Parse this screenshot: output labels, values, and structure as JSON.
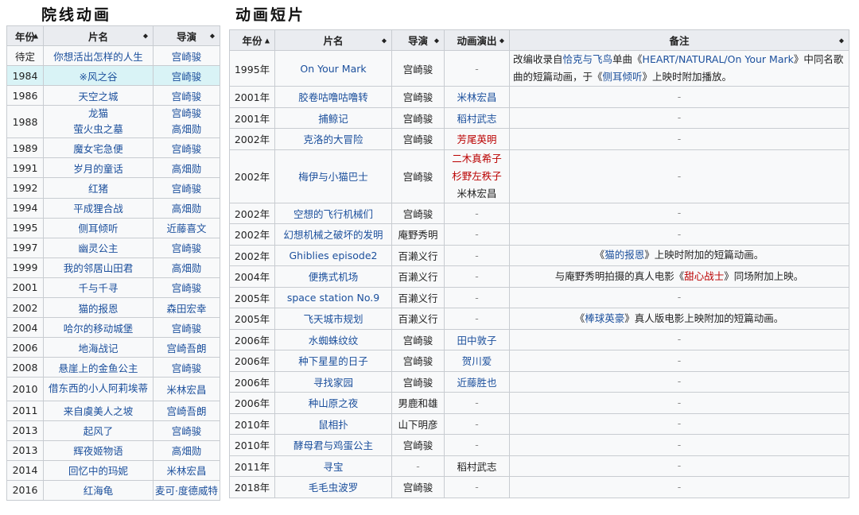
{
  "left": {
    "heading": "院线动画",
    "headers": [
      "年份",
      "片名",
      "导演"
    ],
    "rows": [
      {
        "year": "待定",
        "title": "你想活出怎样的人生",
        "director": [
          "宫崎骏"
        ]
      },
      {
        "year": "1984",
        "title": "※风之谷",
        "director": [
          "宫崎骏"
        ],
        "highlight": true
      },
      {
        "year": "1986",
        "title": "天空之城",
        "director": [
          "宫崎骏"
        ]
      },
      {
        "year": "1988",
        "title": "龙猫\n萤火虫之墓",
        "director": [
          "宫崎骏",
          "高畑勋"
        ]
      },
      {
        "year": "1989",
        "title": "魔女宅急便",
        "director": [
          "宫崎骏"
        ]
      },
      {
        "year": "1991",
        "title": "岁月的童话",
        "director": [
          "高畑勋"
        ]
      },
      {
        "year": "1992",
        "title": "红猪",
        "director": [
          "宫崎骏"
        ]
      },
      {
        "year": "1994",
        "title": "平成狸合战",
        "director": [
          "高畑勋"
        ]
      },
      {
        "year": "1995",
        "title": "侧耳倾听",
        "director": [
          "近藤喜文"
        ]
      },
      {
        "year": "1997",
        "title": "幽灵公主",
        "director": [
          "宫崎骏"
        ]
      },
      {
        "year": "1999",
        "title": "我的邻居山田君",
        "director": [
          "高畑勋"
        ]
      },
      {
        "year": "2001",
        "title": "千与千寻",
        "director": [
          "宫崎骏"
        ]
      },
      {
        "year": "2002",
        "title": "猫的报恩",
        "director": [
          "森田宏幸"
        ]
      },
      {
        "year": "2004",
        "title": "哈尔的移动城堡",
        "director": [
          "宫崎骏"
        ]
      },
      {
        "year": "2006",
        "title": "地海战记",
        "director": [
          "宫崎吾朗"
        ]
      },
      {
        "year": "2008",
        "title": "悬崖上的金鱼公主",
        "director": [
          "宫崎骏"
        ]
      },
      {
        "year": "2010",
        "title": "借东西的小人阿莉埃蒂",
        "director": [
          "米林宏昌"
        ]
      },
      {
        "year": "2011",
        "title": "来自虞美人之坡",
        "director": [
          "宫崎吾朗"
        ]
      },
      {
        "year": "2013",
        "title": "起风了",
        "director": [
          "宫崎骏"
        ]
      },
      {
        "year": "2013",
        "title": "辉夜姬物语",
        "director": [
          "高畑勋"
        ]
      },
      {
        "year": "2014",
        "title": "回忆中的玛妮",
        "director": [
          "米林宏昌"
        ]
      },
      {
        "year": "2016",
        "title": "红海龟",
        "director": [
          "麦可·度德威特"
        ]
      }
    ]
  },
  "right": {
    "heading": "动画短片",
    "headers": [
      "年份",
      "片名",
      "导演",
      "动画演出",
      "备注"
    ],
    "rows": [
      {
        "year": "1995年",
        "title": "On Your Mark",
        "director": "宫崎骏",
        "anim": [
          {
            "t": "-",
            "c": "dash"
          }
        ],
        "note": [
          {
            "t": "改编收录自",
            "c": "plain"
          },
          {
            "t": "恰克与飞鸟",
            "c": "link"
          },
          {
            "t": "单曲《",
            "c": "plain"
          },
          {
            "t": "HEART/NATURAL/On Your Mark",
            "c": "link"
          },
          {
            "t": "》中同名歌曲的短篇动画，于《",
            "c": "plain"
          },
          {
            "t": "侧耳倾听",
            "c": "link"
          },
          {
            "t": "》上映时附加播放。",
            "c": "plain"
          }
        ]
      },
      {
        "year": "2001年",
        "title": "胶卷咕噜咕噜转",
        "director": "宫崎骏",
        "anim": [
          {
            "t": "米林宏昌",
            "c": "link"
          }
        ],
        "note": [
          {
            "t": "-",
            "c": "dash"
          }
        ]
      },
      {
        "year": "2001年",
        "title": "捕鲸记",
        "director": "宫崎骏",
        "anim": [
          {
            "t": "稻村武志",
            "c": "link"
          }
        ],
        "note": [
          {
            "t": "-",
            "c": "dash"
          }
        ]
      },
      {
        "year": "2002年",
        "title": "克洛的大冒险",
        "director": "宫崎骏",
        "anim": [
          {
            "t": "芳尾英明",
            "c": "red"
          }
        ],
        "note": [
          {
            "t": "-",
            "c": "dash"
          }
        ]
      },
      {
        "year": "2002年",
        "title": "梅伊与小猫巴士",
        "director": "宫崎骏",
        "anim": [
          {
            "t": "二木真希子",
            "c": "red"
          },
          {
            "t": "杉野左秩子",
            "c": "red"
          },
          {
            "t": "米林宏昌",
            "c": "plain"
          }
        ],
        "note": [
          {
            "t": "-",
            "c": "dash"
          }
        ]
      },
      {
        "year": "2002年",
        "title": "空想的飞行机械们",
        "director": "宫崎骏",
        "anim": [
          {
            "t": "-",
            "c": "dash"
          }
        ],
        "note": [
          {
            "t": "-",
            "c": "dash"
          }
        ]
      },
      {
        "year": "2002年",
        "title": "幻想机械之破坏的发明",
        "director": "庵野秀明",
        "anim": [
          {
            "t": "-",
            "c": "dash"
          }
        ],
        "note": [
          {
            "t": "-",
            "c": "dash"
          }
        ]
      },
      {
        "year": "2002年",
        "title": "Ghiblies episode2",
        "director": "百濑义行",
        "anim": [
          {
            "t": "-",
            "c": "dash"
          }
        ],
        "note": [
          {
            "t": "《",
            "c": "plain"
          },
          {
            "t": "猫的报恩",
            "c": "link"
          },
          {
            "t": "》上映时附加的短篇动画。",
            "c": "plain"
          }
        ]
      },
      {
        "year": "2004年",
        "title": "便携式机场",
        "director": "百濑义行",
        "anim": [
          {
            "t": "-",
            "c": "dash"
          }
        ],
        "note": [
          {
            "t": "与庵野秀明拍摄的真人电影《",
            "c": "plain"
          },
          {
            "t": "甜心战士",
            "c": "red"
          },
          {
            "t": "》同场附加上映。",
            "c": "plain"
          }
        ]
      },
      {
        "year": "2005年",
        "title": "space station No.9",
        "director": "百濑义行",
        "anim": [
          {
            "t": "-",
            "c": "dash"
          }
        ],
        "note": [
          {
            "t": "-",
            "c": "dash"
          }
        ]
      },
      {
        "year": "2005年",
        "title": "飞天城市规划",
        "director": "百濑义行",
        "anim": [
          {
            "t": "-",
            "c": "dash"
          }
        ],
        "note": [
          {
            "t": "《",
            "c": "plain"
          },
          {
            "t": "棒球英豪",
            "c": "link"
          },
          {
            "t": "》真人版电影上映附加的短篇动画。",
            "c": "plain"
          }
        ]
      },
      {
        "year": "2006年",
        "title": "水蜘蛛纹纹",
        "director": "宫崎骏",
        "anim": [
          {
            "t": "田中敦子",
            "c": "link"
          }
        ],
        "note": [
          {
            "t": "-",
            "c": "dash"
          }
        ]
      },
      {
        "year": "2006年",
        "title": "种下星星的日子",
        "director": "宫崎骏",
        "anim": [
          {
            "t": "贺川爱",
            "c": "link"
          }
        ],
        "note": [
          {
            "t": "-",
            "c": "dash"
          }
        ]
      },
      {
        "year": "2006年",
        "title": "寻找家园",
        "director": "宫崎骏",
        "anim": [
          {
            "t": "近藤胜也",
            "c": "link"
          }
        ],
        "note": [
          {
            "t": "-",
            "c": "dash"
          }
        ]
      },
      {
        "year": "2006年",
        "title": "种山原之夜",
        "director": "男鹿和雄",
        "anim": [
          {
            "t": "-",
            "c": "dash"
          }
        ],
        "note": [
          {
            "t": "-",
            "c": "dash"
          }
        ]
      },
      {
        "year": "2010年",
        "title": "鼠相扑",
        "director": "山下明彦",
        "anim": [
          {
            "t": "-",
            "c": "dash"
          }
        ],
        "note": [
          {
            "t": "-",
            "c": "dash"
          }
        ]
      },
      {
        "year": "2010年",
        "title": "酵母君与鸡蛋公主",
        "director": "宫崎骏",
        "anim": [
          {
            "t": "-",
            "c": "dash"
          }
        ],
        "note": [
          {
            "t": "-",
            "c": "dash"
          }
        ]
      },
      {
        "year": "2011年",
        "title": "寻宝",
        "director": "-",
        "anim": [
          {
            "t": "稻村武志",
            "c": "plain"
          }
        ],
        "note": [
          {
            "t": "-",
            "c": "dash"
          }
        ]
      },
      {
        "year": "2018年",
        "title": "毛毛虫波罗",
        "director": "宫崎骏",
        "anim": [
          {
            "t": "-",
            "c": "dash"
          }
        ],
        "note": [
          {
            "t": "-",
            "c": "dash"
          }
        ]
      }
    ]
  }
}
